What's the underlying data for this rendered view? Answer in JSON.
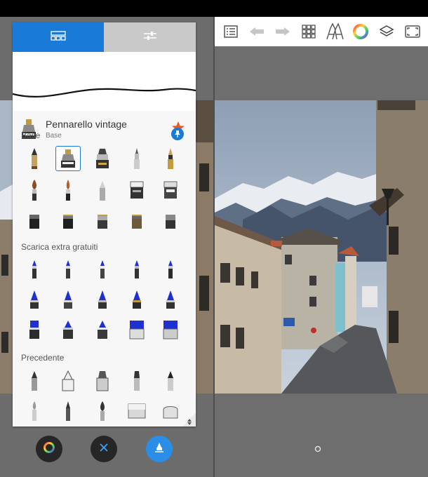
{
  "panel": {
    "tabs": [
      {
        "name": "brush-library",
        "icon": "brush-library-icon"
      },
      {
        "name": "brush-settings",
        "icon": "sliders-icon"
      }
    ],
    "current_brush": {
      "name": "Pennarello vintage",
      "set": "Base",
      "favorite": true
    },
    "sections": [
      {
        "title": "Base",
        "rows": 3,
        "columns": 5
      },
      {
        "title": "Scarica extra gratuiti",
        "rows": 3,
        "columns": 5
      },
      {
        "title": "Precedente",
        "rows": 2,
        "columns": 5
      }
    ],
    "selected_brush": {
      "section": "Base",
      "row": 1,
      "column": 2
    }
  },
  "toolbar": {
    "buttons": [
      "list-icon",
      "undo-icon",
      "redo-icon",
      "grid-icon",
      "brush-pens-icon",
      "color-wheel-icon",
      "layers-icon",
      "fullscreen-icon"
    ]
  },
  "fabs": [
    "color-wheel-icon",
    "close-icon",
    "brush-icon"
  ],
  "colors": {
    "accent": "#1a7ad8",
    "fab_accent": "#2a8ee8",
    "star": "#f05a22",
    "panel_bg": "#f7f7f7",
    "brush_blue": "#1f2fd0"
  }
}
